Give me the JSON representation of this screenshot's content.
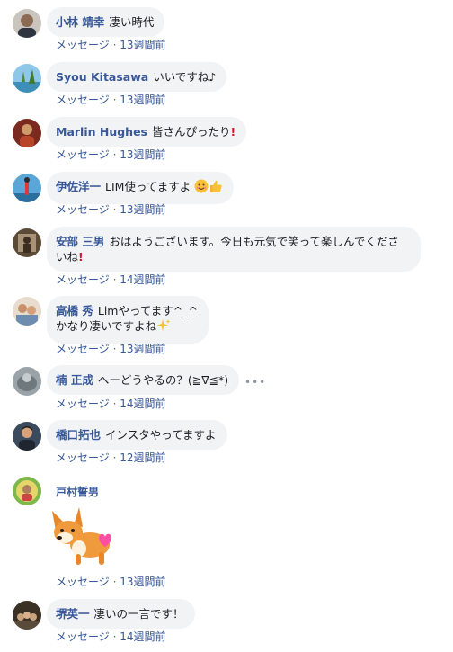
{
  "meta_link": "メッセージ",
  "meta_sep": " · ",
  "comments": [
    {
      "name": "小林 靖幸",
      "text": "凄い時代",
      "time": "13週間前"
    },
    {
      "name": "Syou Kitasawa",
      "text": "いいですね♪",
      "time": "13週間前"
    },
    {
      "name": "Marlin Hughes",
      "text": "皆さんぴったり",
      "time": "13週間前"
    },
    {
      "name": "伊佐洋一",
      "text": "LIM使ってますよ",
      "time": "13週間前"
    },
    {
      "name": "安部 三男",
      "text": "おはようございます。今日も元気で笑って楽しんでくださ",
      "text2": "いね",
      "time": "14週間前"
    },
    {
      "name": "高橋 秀",
      "text": "Limやってます^_^",
      "text2": "かなり凄いですよね",
      "time": "13週間前"
    },
    {
      "name": "楠 正成",
      "text": "へーどうやるの？(≧∇≦*)",
      "time": "14週間前"
    },
    {
      "name": "橋口拓也",
      "text": "インスタやってますよ",
      "time": "12週間前"
    },
    {
      "name": "戸村誓男",
      "text": "",
      "time": "13週間前"
    },
    {
      "name": "堺英一",
      "text": "凄いの一言です！",
      "time": "14週間前"
    }
  ],
  "icons": {
    "exclamation": "!",
    "more": "•••",
    "smile": "smiling-face-icon",
    "thumbs": "thumbs-up-icon",
    "sparkles": "sparkles-icon",
    "sticker": "corgi-heart-sticker"
  },
  "colors": {
    "name": "#385898",
    "bubble": "#f2f3f5",
    "meta": "#606770",
    "exclamation": "#e0102b"
  }
}
